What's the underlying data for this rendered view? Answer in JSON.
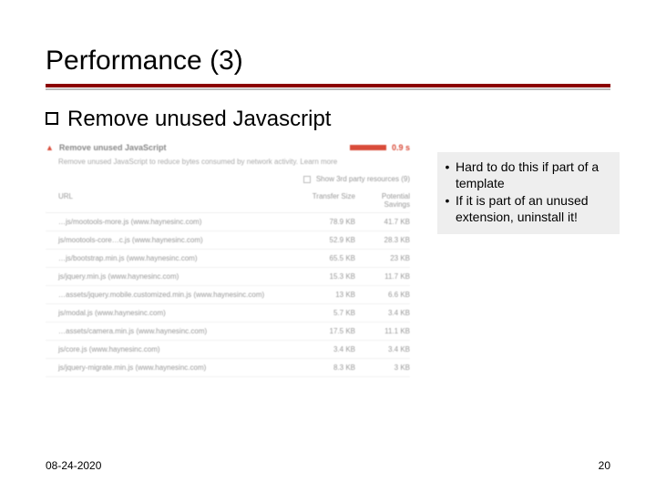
{
  "title": "Performance (3)",
  "subheading": "Remove unused Javascript",
  "devtools": {
    "section_title": "Remove unused JavaScript",
    "score": "0.9 s",
    "description": "Remove unused JavaScript to reduce bytes consumed by network activity. Learn more",
    "filter_label": "Show 3rd party resources (9)",
    "headers": {
      "url": "URL",
      "size": "Transfer Size",
      "savings": "Potential Savings"
    },
    "rows": [
      {
        "url": "…js/mootools-more.js  (www.haynesinc.com)",
        "size": "78.9 KB",
        "savings": "41.7 KB"
      },
      {
        "url": "js/mootools-core…c.js  (www.haynesinc.com)",
        "size": "52.9 KB",
        "savings": "28.3 KB"
      },
      {
        "url": "…js/bootstrap.min.js  (www.haynesinc.com)",
        "size": "65.5 KB",
        "savings": "23 KB"
      },
      {
        "url": "js/jquery.min.js  (www.haynesinc.com)",
        "size": "15.3 KB",
        "savings": "11.7 KB"
      },
      {
        "url": "…assets/jquery.mobile.customized.min.js  (www.haynesinc.com)",
        "size": "13 KB",
        "savings": "6.6 KB"
      },
      {
        "url": "js/modal.js  (www.haynesinc.com)",
        "size": "5.7 KB",
        "savings": "3.4 KB"
      },
      {
        "url": "…assets/camera.min.js  (www.haynesinc.com)",
        "size": "17.5 KB",
        "savings": "11.1 KB"
      },
      {
        "url": "js/core.js  (www.haynesinc.com)",
        "size": "3.4 KB",
        "savings": "3.4 KB"
      },
      {
        "url": "js/jquery-migrate.min.js  (www.haynesinc.com)",
        "size": "8.3 KB",
        "savings": "3 KB"
      }
    ]
  },
  "callout": {
    "items": [
      "Hard to do this if part of a template",
      "If it is part of an unused extension, uninstall it!"
    ]
  },
  "footer": {
    "date": "08-24-2020",
    "page": "20"
  }
}
